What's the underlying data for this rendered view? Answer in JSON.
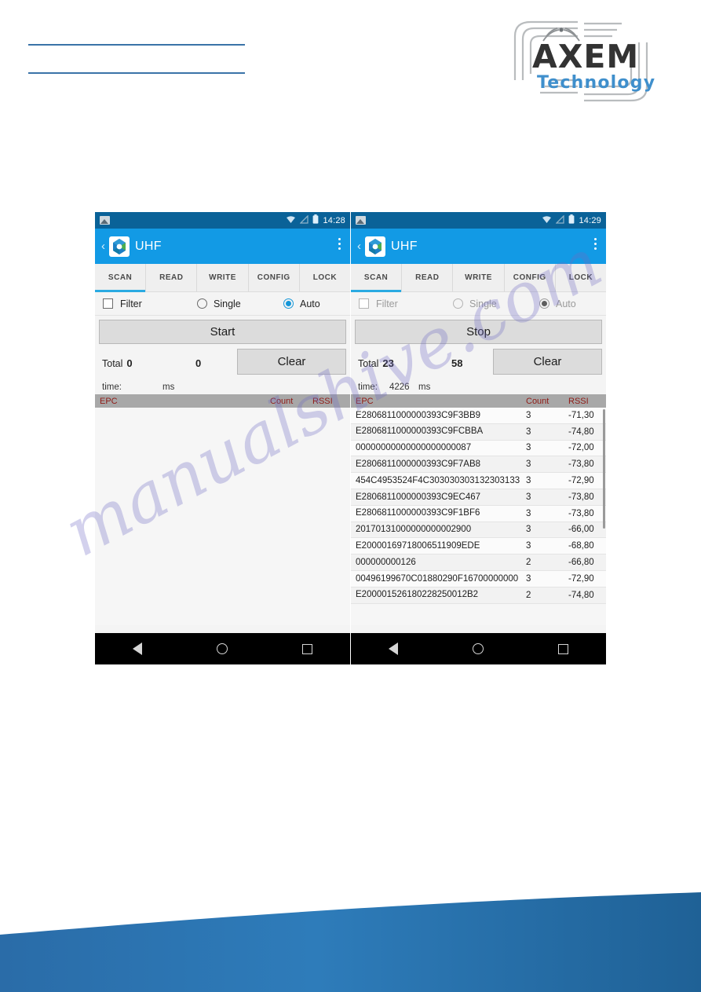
{
  "page": {
    "watermark": "manualshive.com",
    "brand": {
      "name": "AXEM",
      "tagline": "Technology"
    }
  },
  "phones": [
    {
      "id": "left",
      "statusbar": {
        "time": "14:28",
        "icons": [
          "photo-icon",
          "wifi-icon",
          "signal-off-icon",
          "battery-icon"
        ]
      },
      "appbar": {
        "title": "UHF",
        "back": "‹",
        "menu": "overflow-menu-icon"
      },
      "tabs": [
        {
          "label": "SCAN",
          "active": true
        },
        {
          "label": "READ",
          "active": false
        },
        {
          "label": "WRITE",
          "active": false
        },
        {
          "label": "CONFIG",
          "active": false
        },
        {
          "label": "LOCK",
          "active": false
        }
      ],
      "controls": {
        "disabled": false,
        "filter_label": "Filter",
        "filter_checked": false,
        "single_label": "Single",
        "single_selected": false,
        "auto_label": "Auto",
        "auto_selected": true
      },
      "action_button": "Start",
      "totals": {
        "total_label": "Total",
        "total_value": "0",
        "second_value": "0",
        "clear_label": "Clear"
      },
      "time": {
        "label": "time:",
        "value": "",
        "unit": "ms"
      },
      "table": {
        "headers": {
          "epc": "EPC",
          "count": "Count",
          "rssi": "RSSI"
        },
        "rows": []
      },
      "navbar": [
        "back-icon",
        "home-icon",
        "recents-icon"
      ]
    },
    {
      "id": "right",
      "statusbar": {
        "time": "14:29",
        "icons": [
          "photo-icon",
          "wifi-icon",
          "signal-off-icon",
          "battery-icon"
        ]
      },
      "appbar": {
        "title": "UHF",
        "back": "‹",
        "menu": "overflow-menu-icon"
      },
      "tabs": [
        {
          "label": "SCAN",
          "active": true
        },
        {
          "label": "READ",
          "active": false
        },
        {
          "label": "WRITE",
          "active": false
        },
        {
          "label": "CONFIG",
          "active": false
        },
        {
          "label": "LOCK",
          "active": false
        }
      ],
      "controls": {
        "disabled": true,
        "filter_label": "Filter",
        "filter_checked": false,
        "single_label": "Single",
        "single_selected": false,
        "auto_label": "Auto",
        "auto_selected": true
      },
      "action_button": "Stop",
      "totals": {
        "total_label": "Total",
        "total_value": "23",
        "second_value": "58",
        "clear_label": "Clear"
      },
      "time": {
        "label": "time:",
        "value": "4226",
        "unit": "ms"
      },
      "table": {
        "headers": {
          "epc": "EPC",
          "count": "Count",
          "rssi": "RSSI"
        },
        "rows": [
          {
            "epc": "E2806811000000393C9F3BB9",
            "count": "3",
            "rssi": "-71,30"
          },
          {
            "epc": "E2806811000000393C9FCBBA",
            "count": "3",
            "rssi": "-74,80"
          },
          {
            "epc": "00000000000000000000087",
            "count": "3",
            "rssi": "-72,00"
          },
          {
            "epc": "E2806811000000393C9F7AB8",
            "count": "3",
            "rssi": "-73,80"
          },
          {
            "epc": "454C4953524F4C303030303132303133",
            "count": "3",
            "rssi": "-72,90"
          },
          {
            "epc": "E2806811000000393C9EC467",
            "count": "3",
            "rssi": "-73,80"
          },
          {
            "epc": "E2806811000000393C9F1BF6",
            "count": "3",
            "rssi": "-73,80"
          },
          {
            "epc": "20170131000000000002900",
            "count": "3",
            "rssi": "-66,00"
          },
          {
            "epc": "E20000169718006511909EDE",
            "count": "3",
            "rssi": "-68,80"
          },
          {
            "epc": "000000000126",
            "count": "2",
            "rssi": "-66,80"
          },
          {
            "epc": "00496199670C01880290F16700000000",
            "count": "3",
            "rssi": "-72,90"
          },
          {
            "epc": "E200001526180228250012B2",
            "count": "2",
            "rssi": "-74,80"
          }
        ]
      },
      "navbar": [
        "back-icon",
        "home-icon",
        "recents-icon"
      ]
    }
  ]
}
